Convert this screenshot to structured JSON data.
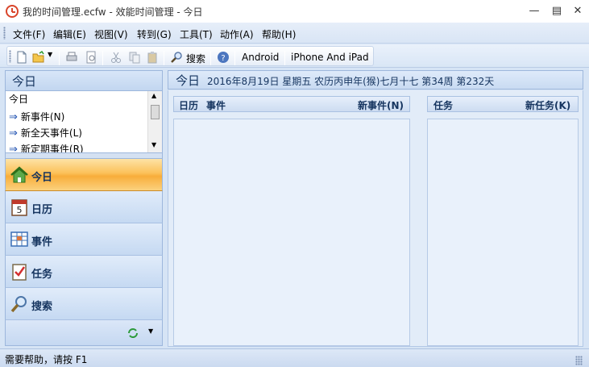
{
  "window": {
    "title": "我的时间管理.ecfw - 效能时间管理 - 今日"
  },
  "menu": [
    "文件(F)",
    "编辑(E)",
    "视图(V)",
    "转到(G)",
    "工具(T)",
    "动作(A)",
    "帮助(H)"
  ],
  "toolbar": {
    "search_label": "搜索",
    "android_label": "Android",
    "ios_label": "iPhone And iPad"
  },
  "left_panel": {
    "title": "今日",
    "list": [
      "今日",
      "新事件(N)",
      "新全天事件(L)",
      "新定期事件(R)"
    ],
    "nav": [
      {
        "label": "今日",
        "icon": "home-icon",
        "active": true
      },
      {
        "label": "日历",
        "icon": "calendar-icon"
      },
      {
        "label": "事件",
        "icon": "event-grid-icon"
      },
      {
        "label": "任务",
        "icon": "task-check-icon"
      },
      {
        "label": "搜索",
        "icon": "magnifier-icon"
      }
    ]
  },
  "right_header": {
    "title": "今日",
    "date_info": "2016年8月19日 星期五 农历丙申年(猴)七月十七  第34周 第232天"
  },
  "events_panel": {
    "col1": "日历",
    "col2": "事件",
    "action": "新事件(N)"
  },
  "tasks_panel": {
    "col1": "任务",
    "action": "新任务(K)"
  },
  "status": "需要帮助，请按 F1",
  "colors": {
    "accent_active": "#fcc15a",
    "panel_bg": "#d6e4f5",
    "header_text": "#15345f"
  }
}
